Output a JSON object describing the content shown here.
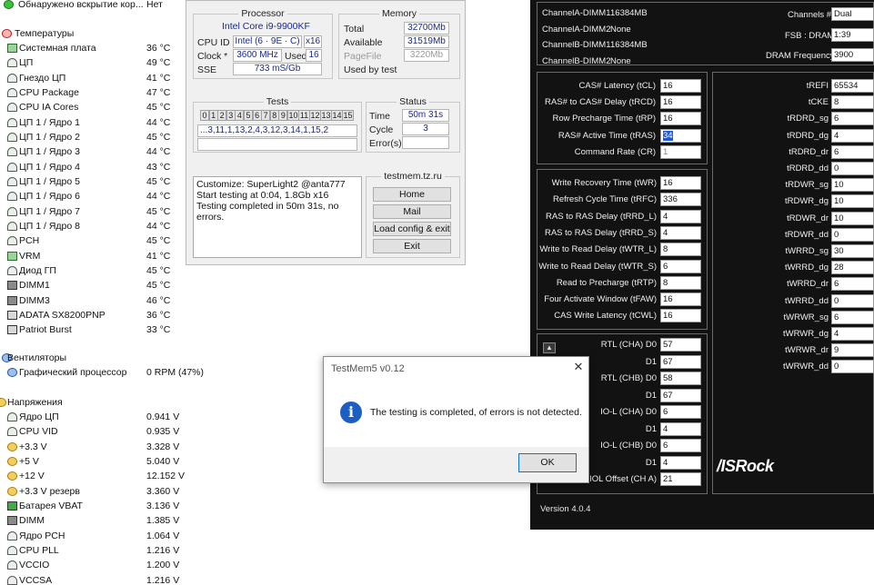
{
  "sensors": {
    "top_row": {
      "label": "Обнаружено вскрытие кор...",
      "value": "Нет"
    },
    "temps_group": "Температуры",
    "temps": [
      {
        "label": "Системная плата",
        "value": "36 °C",
        "icon": "motherboard-icon"
      },
      {
        "label": "ЦП",
        "value": "49 °C",
        "icon": "gauge-icon"
      },
      {
        "label": "Гнездо ЦП",
        "value": "41 °C",
        "icon": "gauge-icon"
      },
      {
        "label": "CPU Package",
        "value": "47 °C",
        "icon": "gauge-icon"
      },
      {
        "label": "CPU IA Cores",
        "value": "45 °C",
        "icon": "gauge-icon"
      },
      {
        "label": "ЦП 1 / Ядро 1",
        "value": "44 °C",
        "icon": "gauge-icon"
      },
      {
        "label": "ЦП 1 / Ядро 2",
        "value": "45 °C",
        "icon": "gauge-icon"
      },
      {
        "label": "ЦП 1 / Ядро 3",
        "value": "44 °C",
        "icon": "gauge-icon"
      },
      {
        "label": "ЦП 1 / Ядро 4",
        "value": "43 °C",
        "icon": "gauge-icon"
      },
      {
        "label": "ЦП 1 / Ядро 5",
        "value": "45 °C",
        "icon": "gauge-icon"
      },
      {
        "label": "ЦП 1 / Ядро 6",
        "value": "44 °C",
        "icon": "gauge-icon"
      },
      {
        "label": "ЦП 1 / Ядро 7",
        "value": "45 °C",
        "icon": "gauge-icon"
      },
      {
        "label": "ЦП 1 / Ядро 8",
        "value": "44 °C",
        "icon": "gauge-icon"
      },
      {
        "label": "PCH",
        "value": "45 °C",
        "icon": "gauge-icon"
      },
      {
        "label": "VRM",
        "value": "41 °C",
        "icon": "vrm-icon"
      },
      {
        "label": "Диод ГП",
        "value": "45 °C",
        "icon": "gauge-icon"
      },
      {
        "label": "DIMM1",
        "value": "45 °C",
        "icon": "memory-icon"
      },
      {
        "label": "DIMM3",
        "value": "46 °C",
        "icon": "memory-icon"
      },
      {
        "label": "ADATA SX8200PNP",
        "value": "36 °C",
        "icon": "disk-icon"
      },
      {
        "label": "Patriot Burst",
        "value": "33 °C",
        "icon": "disk-icon"
      }
    ],
    "fans_group": "Вентиляторы",
    "fans": [
      {
        "label": "Графический процессор",
        "value": "0 RPM  (47%)",
        "icon": "fan-icon"
      }
    ],
    "volts_group": "Напряжения",
    "volts": [
      {
        "label": "Ядро ЦП",
        "value": "0.941 V",
        "icon": "gauge-icon"
      },
      {
        "label": "CPU VID",
        "value": "0.935 V",
        "icon": "gauge-icon"
      },
      {
        "label": "+3.3 V",
        "value": "3.328 V",
        "icon": "bolt-icon"
      },
      {
        "label": "+5 V",
        "value": "5.040 V",
        "icon": "bolt-icon"
      },
      {
        "label": "+12 V",
        "value": "12.152 V",
        "icon": "bolt-icon"
      },
      {
        "label": "+3.3 V резерв",
        "value": "3.360 V",
        "icon": "bolt-icon"
      },
      {
        "label": "Батарея VBAT",
        "value": "3.136 V",
        "icon": "battery-icon"
      },
      {
        "label": "DIMM",
        "value": "1.385 V",
        "icon": "memory-icon"
      },
      {
        "label": "Ядро PCH",
        "value": "1.064 V",
        "icon": "gauge-icon"
      },
      {
        "label": "CPU PLL",
        "value": "1.216 V",
        "icon": "gauge-icon"
      },
      {
        "label": "VCCIO",
        "value": "1.200 V",
        "icon": "gauge-icon"
      },
      {
        "label": "VCCSA",
        "value": "1.216 V",
        "icon": "gauge-icon"
      }
    ]
  },
  "testmem": {
    "processor_title": "Processor",
    "cpu_name": "Intel Core i9-9900KF",
    "cpu_id_label": "CPU ID",
    "cpu_id_value": "Intel  (6 · 9E · C)",
    "cpu_threads": "x16",
    "clock_label": "Clock *",
    "clock_value": "3600 MHz",
    "used_label": "Used",
    "used_value": "16",
    "sse_label": "SSE",
    "sse_value": "733 mS/Gb",
    "memory_title": "Memory",
    "total_label": "Total",
    "total_value": "32700Mb",
    "available_label": "Available",
    "available_value": "31519Mb",
    "pagefile_label": "PageFile",
    "pagefile_value": "3220Mb",
    "usedbytest_label": "Used by test",
    "tests_title": "Tests",
    "test_cells": [
      "0",
      "1",
      "2",
      "3",
      "4",
      "5",
      "6",
      "7",
      "8",
      "9",
      "10",
      "11",
      "12",
      "13",
      "14",
      "15"
    ],
    "test_sequence": "...3,11,1,13,2,4,3,12,3,14,1,15,2",
    "status_title": "Status",
    "time_label": "Time",
    "time_value": "50m 31s",
    "cycle_label": "Cycle",
    "cycle_value": "3",
    "errors_label": "Error(s)",
    "log": [
      "Customize: SuperLight2 @anta777",
      "Start testing at 0:04, 1.8Gb x16",
      "Testing completed in 50m 31s, no errors."
    ],
    "site_title": "testmem.tz.ru",
    "btn_home": "Home",
    "btn_mail": "Mail",
    "btn_load": "Load config & exit",
    "btn_exit": "Exit"
  },
  "dialog": {
    "title": "TestMem5 v0.12",
    "message": "The testing is completed, of errors is not detected.",
    "ok": "OK",
    "close": "✕"
  },
  "asrock": {
    "channels": [
      {
        "label": "ChannelA-DIMM1",
        "value": "16384MB"
      },
      {
        "label": "ChannelA-DIMM2",
        "value": "None"
      },
      {
        "label": "ChannelB-DIMM1",
        "value": "16384MB"
      },
      {
        "label": "ChannelB-DIMM2",
        "value": "None"
      }
    ],
    "channels_num_label": "Channels #",
    "channels_num_value": "Dual",
    "fsb_label": "FSB : DRAM",
    "fsb_value": "1:39",
    "freq_label": "DRAM Frequency",
    "freq_value": "3900",
    "primary": [
      {
        "label": "CAS# Latency (tCL)",
        "value": "16"
      },
      {
        "label": "RAS# to CAS# Delay (tRCD)",
        "value": "16"
      },
      {
        "label": "Row Precharge Time (tRP)",
        "value": "16"
      },
      {
        "label": "RAS# Active Time (tRAS)",
        "value": "34"
      },
      {
        "label": "Command Rate (CR)",
        "value": "1"
      }
    ],
    "secondary": [
      {
        "label": "Write Recovery Time (tWR)",
        "value": "16"
      },
      {
        "label": "Refresh Cycle Time (tRFC)",
        "value": "336"
      },
      {
        "label": "RAS to RAS Delay (tRRD_L)",
        "value": "4"
      },
      {
        "label": "RAS to RAS Delay (tRRD_S)",
        "value": "4"
      },
      {
        "label": "Write to Read Delay (tWTR_L)",
        "value": "8"
      },
      {
        "label": "Write to Read Delay (tWTR_S)",
        "value": "6"
      },
      {
        "label": "Read to Precharge (tRTP)",
        "value": "8"
      },
      {
        "label": "Four Activate Window (tFAW)",
        "value": "16"
      },
      {
        "label": "CAS Write Latency (tCWL)",
        "value": "16"
      }
    ],
    "rtl": [
      {
        "label": "RTL (CHA) D0",
        "value": "57"
      },
      {
        "label": "D1",
        "value": "67"
      },
      {
        "label": "RTL (CHB) D0",
        "value": "58"
      },
      {
        "label": "D1",
        "value": "67"
      },
      {
        "label": "IO-L (CHA) D0",
        "value": "6"
      },
      {
        "label": "D1",
        "value": "4"
      },
      {
        "label": "IO-L (CHB) D0",
        "value": "6"
      },
      {
        "label": "D1",
        "value": "4"
      },
      {
        "label": "IOL Offset (CH A)",
        "value": "21"
      }
    ],
    "right": [
      {
        "label": "tREFI",
        "value": "65534"
      },
      {
        "label": "tCKE",
        "value": "8"
      },
      {
        "label": "tRDRD_sg",
        "value": "6"
      },
      {
        "label": "tRDRD_dg",
        "value": "4"
      },
      {
        "label": "tRDRD_dr",
        "value": "6"
      },
      {
        "label": "tRDRD_dd",
        "value": "0"
      },
      {
        "label": "tRDWR_sg",
        "value": "10"
      },
      {
        "label": "tRDWR_dg",
        "value": "10"
      },
      {
        "label": "tRDWR_dr",
        "value": "10"
      },
      {
        "label": "tRDWR_dd",
        "value": "0"
      },
      {
        "label": "tWRRD_sg",
        "value": "30"
      },
      {
        "label": "tWRRD_dg",
        "value": "28"
      },
      {
        "label": "tWRRD_dr",
        "value": "6"
      },
      {
        "label": "tWRRD_dd",
        "value": "0"
      },
      {
        "label": "tWRWR_sg",
        "value": "6"
      },
      {
        "label": "tWRWR_dg",
        "value": "4"
      },
      {
        "label": "tWRWR_dr",
        "value": "9"
      },
      {
        "label": "tWRWR_dd",
        "value": "0"
      }
    ],
    "logo": "/ISRock",
    "version": "Version 4.0.4",
    "scroll_up": "▲"
  }
}
